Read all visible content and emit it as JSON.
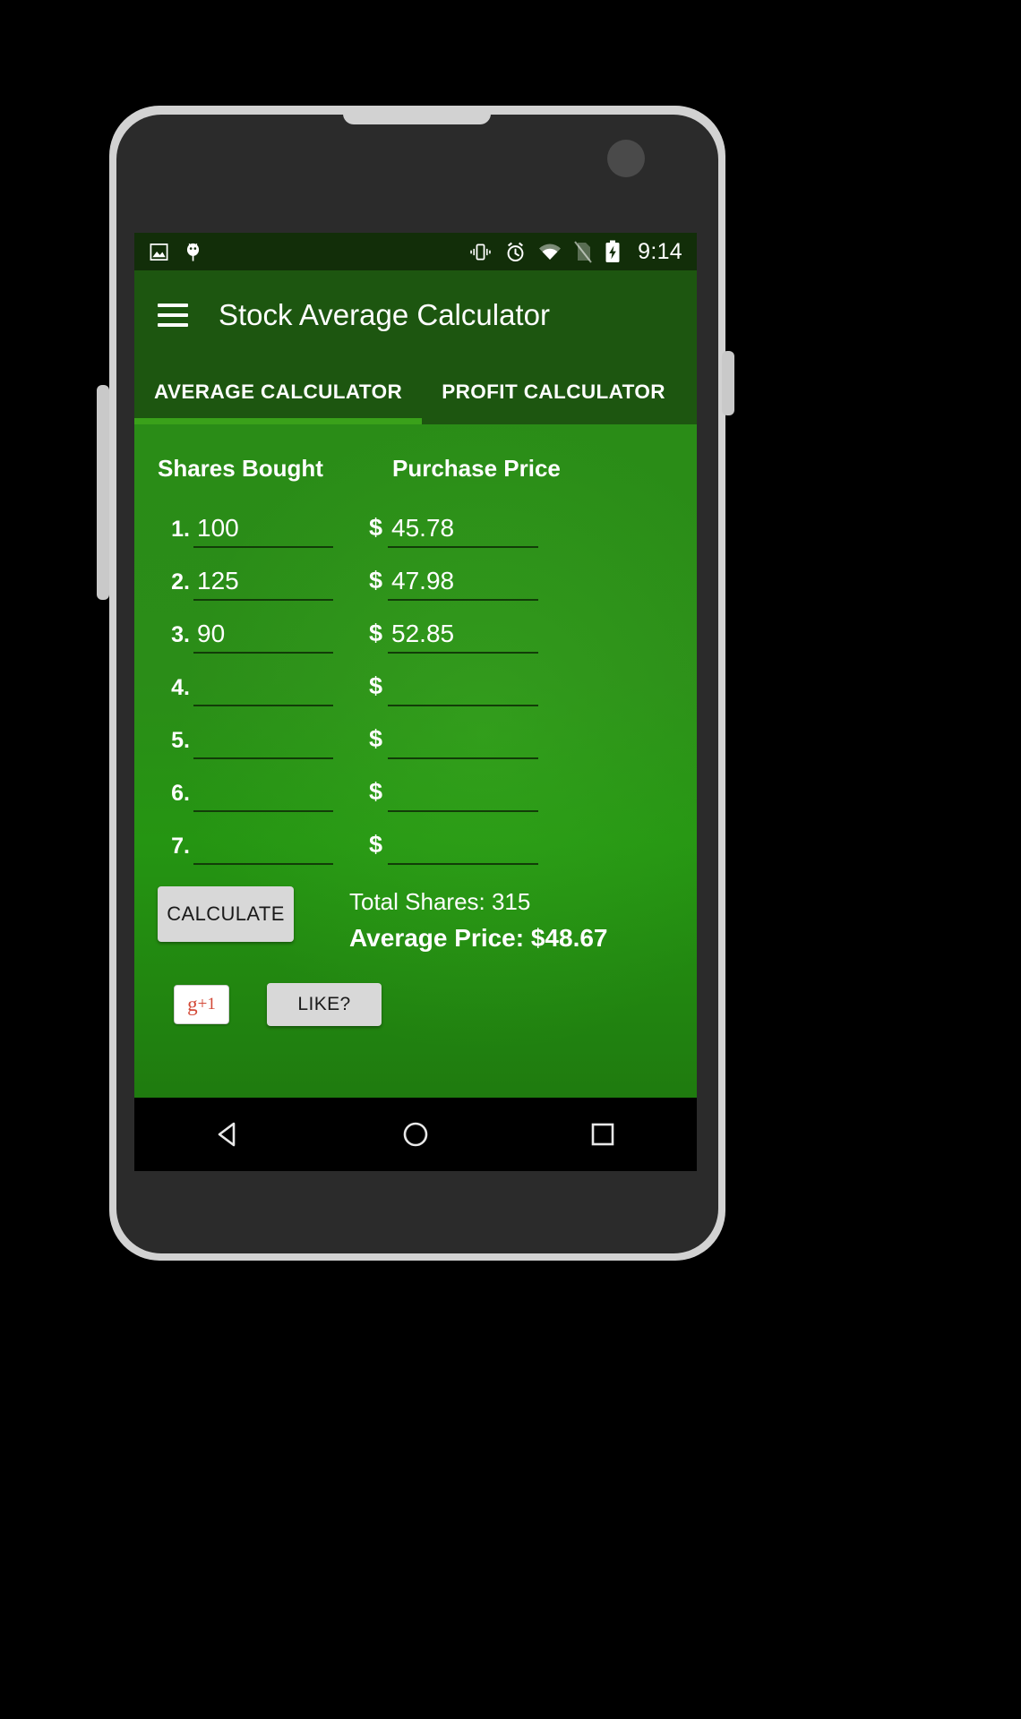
{
  "device": {
    "frame_color": "#d2d2d2",
    "body_color": "#2b2b2b"
  },
  "status_bar": {
    "background": "#122e09",
    "time": "9:14",
    "left_icons": [
      "image-icon",
      "android-debug-icon"
    ],
    "right_icons": [
      "vibrate-icon",
      "alarm-icon",
      "wifi-icon",
      "no-sim-icon",
      "battery-charging-icon"
    ]
  },
  "appbar": {
    "background": "#1d5610",
    "menu_icon": "hamburger-menu-icon",
    "title": "Stock Average Calculator"
  },
  "tabs": {
    "active_index": 0,
    "indicator_color": "#3aa11a",
    "items": [
      {
        "label": "AVERAGE CALCULATOR"
      },
      {
        "label": "PROFIT CALCULATOR"
      }
    ]
  },
  "form": {
    "headers": {
      "shares": "Shares Bought",
      "price": "Purchase Price"
    },
    "currency_symbol": "$",
    "rows": [
      {
        "num": "1.",
        "shares": "100",
        "price": "45.78"
      },
      {
        "num": "2.",
        "shares": "125",
        "price": "47.98"
      },
      {
        "num": "3.",
        "shares": "90",
        "price": "52.85"
      },
      {
        "num": "4.",
        "shares": "",
        "price": ""
      },
      {
        "num": "5.",
        "shares": "",
        "price": ""
      },
      {
        "num": "6.",
        "shares": "",
        "price": ""
      },
      {
        "num": "7.",
        "shares": "",
        "price": ""
      }
    ]
  },
  "actions": {
    "calculate_label": "CALCULATE",
    "like_label": "LIKE?",
    "gplus_g": "g",
    "gplus_plus": "+1"
  },
  "results": {
    "total_shares": "Total Shares: 315",
    "average_price": "Average Price: $48.67"
  },
  "navbar": {
    "back": "back-triangle-icon",
    "home": "home-circle-icon",
    "recents": "recents-square-icon"
  }
}
